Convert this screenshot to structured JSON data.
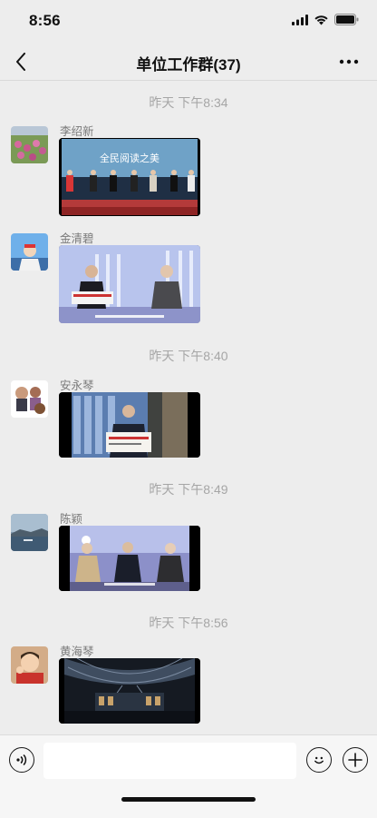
{
  "status_bar": {
    "time": "8:56",
    "icons": [
      "signal-icon",
      "wifi-icon",
      "battery-icon"
    ]
  },
  "header": {
    "title": "单位工作群(37)",
    "back_icon": "chevron-left-icon",
    "more_icon": "more-dots-icon"
  },
  "messages": [
    {
      "type": "timestamp",
      "text": "昨天 下午8:34"
    },
    {
      "type": "video",
      "sender": "李绍新",
      "avatar": "flower-field-avatar",
      "caption": "全民阅读之美"
    },
    {
      "type": "video",
      "sender": "金清碧",
      "avatar": "person-outdoor-avatar"
    },
    {
      "type": "timestamp",
      "text": "昨天 下午8:40"
    },
    {
      "type": "video",
      "sender": "安永琴",
      "avatar": "family-photo-avatar"
    },
    {
      "type": "timestamp",
      "text": "昨天 下午8:49"
    },
    {
      "type": "video",
      "sender": "陈颖",
      "avatar": "lake-landscape-avatar"
    },
    {
      "type": "timestamp",
      "text": "昨天 下午8:56"
    },
    {
      "type": "video",
      "sender": "黄海琴",
      "avatar": "child-portrait-avatar"
    }
  ],
  "input_bar": {
    "placeholder": "",
    "voice_icon": "voice-icon",
    "emoji_icon": "emoji-icon",
    "plus_icon": "plus-icon"
  },
  "colors": {
    "background": "#ededed",
    "timestamp": "#a6a6a6",
    "sender_name": "#7a7a7a",
    "input_bar": "#f6f6f6"
  }
}
